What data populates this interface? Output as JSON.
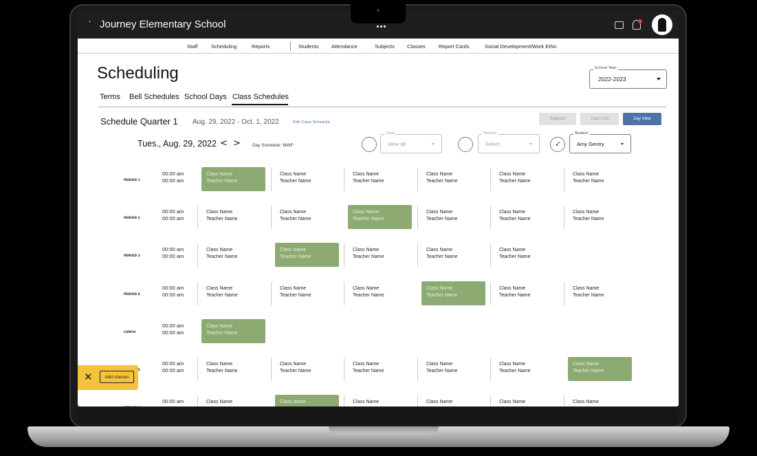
{
  "app": {
    "title": "Journey Elementary School",
    "leaf_glyph": "‘"
  },
  "nav": [
    "Staff",
    "Scheduling",
    "Reports",
    "Students",
    "Attendance",
    "Subjects",
    "Classes",
    "Report Cards",
    "Social Development/Work Ethic"
  ],
  "page_title": "Scheduling",
  "subtabs": [
    "Terms",
    "Bell Schedules",
    "School Days",
    "Class Schedules"
  ],
  "school_year": {
    "legend": "School Year",
    "value": "2022-2023"
  },
  "schedule": {
    "title": "Schedule Quarter 1",
    "dates": "Aug. 29, 2022 - Oct. 1, 2022",
    "edit_link": "Edit Class Schedule",
    "buttons": [
      "Subjects",
      "Class List",
      "Day View"
    ]
  },
  "day": {
    "date": "Tues., Aug. 29, 2022",
    "prev": "<",
    "next": ">",
    "day_schedule": "Day Schedule: MWF"
  },
  "filters": {
    "class": {
      "legend": "Class",
      "value": "View all"
    },
    "teacher": {
      "legend": "Teacher",
      "value": "Select"
    },
    "student": {
      "legend": "Student",
      "value": "Amy Gentry"
    }
  },
  "rows": [
    {
      "label": "PERIOD 1",
      "times": [
        "00:00 am",
        "00:00 am"
      ],
      "cells": [
        {
          "c": "Class Name",
          "t": "Teacher Name",
          "hl": true
        },
        {
          "c": "Class Name",
          "t": "Teacher Name"
        },
        {
          "c": "Class Name",
          "t": "Teacher Name"
        },
        {
          "c": "Class Name",
          "t": "Teacher Name"
        },
        {
          "c": "Class Name",
          "t": "Teacher Name"
        },
        {
          "c": "Class Name",
          "t": "Teacher Name"
        }
      ]
    },
    {
      "label": "PERIOD 2",
      "times": [
        "00:00 am",
        "00:00 am"
      ],
      "cells": [
        {
          "c": "Class Name",
          "t": "Teacher Name"
        },
        {
          "c": "Class Name",
          "t": "Teacher Name"
        },
        {
          "c": "Class Name",
          "t": "Teacher Name",
          "hl": true
        },
        {
          "c": "Class Name",
          "t": "Teacher Name"
        },
        {
          "c": "Class Name",
          "t": "Teacher Name"
        },
        {
          "c": "Class Name",
          "t": "Teacher Name"
        }
      ]
    },
    {
      "label": "PERIOD 3",
      "times": [
        "00:00 am",
        "00:00 am"
      ],
      "cells": [
        {
          "c": "Class Name",
          "t": "Teacher Name"
        },
        {
          "c": "Class Name",
          "t": "Teacher Name",
          "hl": true
        },
        {
          "c": "Class Name",
          "t": "Teacher Name"
        },
        {
          "c": "Class Name",
          "t": "Teacher Name"
        },
        {
          "c": "Class Name",
          "t": "Teacher Name"
        }
      ]
    },
    {
      "label": "PERIOD 4",
      "times": [
        "00:00 am",
        "00:00 am"
      ],
      "cells": [
        {
          "c": "Class Name",
          "t": "Teacher Name"
        },
        {
          "c": "Class Name",
          "t": "Teacher Name"
        },
        {
          "c": "Class Name",
          "t": "Teacher Name"
        },
        {
          "c": "Class Name",
          "t": "Teacher Name",
          "hl": true
        },
        {
          "c": "Class Name",
          "t": "Teacher Name"
        },
        {
          "c": "Class Name",
          "t": "Teacher Name"
        }
      ]
    },
    {
      "label": "LUNCH",
      "times": [
        "00:00 am",
        "00:00 am"
      ],
      "cells": [
        {
          "c": "Class Name",
          "t": "Teacher Name",
          "hl": true
        }
      ]
    },
    {
      "label": "PERIOD 5",
      "times": [
        "00:00 am",
        "00:00 am"
      ],
      "cells": [
        {
          "c": "Class Name",
          "t": "Teacher Name"
        },
        {
          "c": "Class Name",
          "t": "Teacher Name"
        },
        {
          "c": "Class Name",
          "t": "Teacher Name"
        },
        {
          "c": "Class Name",
          "t": "Teacher Name"
        },
        {
          "c": "Class Name",
          "t": "Teacher Name"
        },
        {
          "c": "Class Name",
          "t": "Teacher Name",
          "hl": true
        }
      ]
    },
    {
      "label": "PERIOD 6",
      "times": [
        "00:00 am",
        ""
      ],
      "cells": [
        {
          "c": "Class Name",
          "t": ""
        },
        {
          "c": "Class Name",
          "t": "",
          "hl": true
        },
        {
          "c": "Class Name",
          "t": ""
        },
        {
          "c": "Class Name",
          "t": ""
        },
        {
          "c": "Class Name",
          "t": ""
        },
        {
          "c": "Class Name",
          "t": ""
        }
      ]
    }
  ],
  "toast": {
    "close": "✕",
    "button": "Add classes"
  },
  "colors": {
    "highlight": "#8caa72",
    "accent": "#4f73a8",
    "toast": "#f3c33b"
  }
}
